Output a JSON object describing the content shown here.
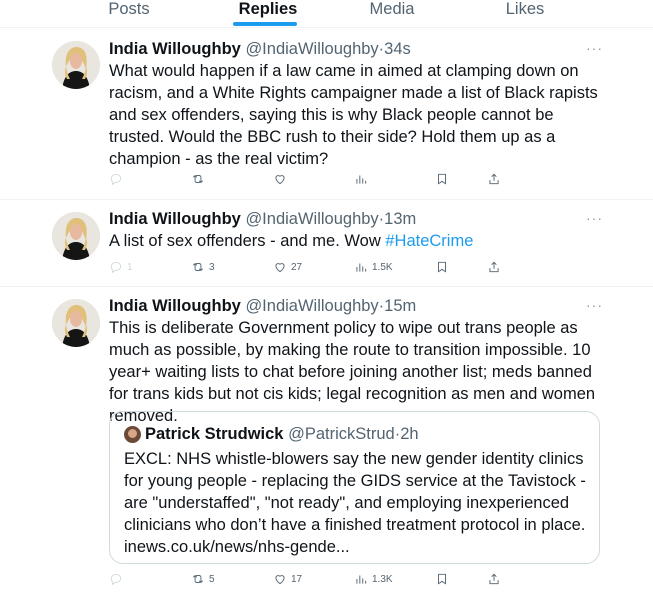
{
  "tabs": [
    {
      "label": "Posts"
    },
    {
      "label": "Replies"
    },
    {
      "label": "Media"
    },
    {
      "label": "Likes"
    }
  ],
  "tweets": [
    {
      "name": "India Willoughby",
      "handle": "@IndiaWilloughby",
      "separator": "·",
      "time": "34s",
      "more": "···",
      "text": "What would happen if a law came in aimed at clamping down on racism, and a White Rights campaigner made a list of Black rapists and sex offenders, saying this is why Black people cannot be trusted. Would the BBC rush to their side? Hold them up as a champion - as the real victim?",
      "replies": "",
      "reposts": "",
      "likes": "",
      "views": ""
    },
    {
      "name": "India Willoughby",
      "handle": "@IndiaWilloughby",
      "separator": "·",
      "time": "13m",
      "more": "···",
      "text": "A list of sex offenders - and me. Wow ",
      "hashtag": "#HateCrime",
      "replies": "1",
      "reposts": "3",
      "likes": "27",
      "views": "1.5K"
    },
    {
      "name": "India Willoughby",
      "handle": "@IndiaWilloughby",
      "separator": "·",
      "time": "15m",
      "more": "···",
      "text": "This is deliberate Government policy to wipe out trans people as much as possible, by making the route to transition impossible. 10 year+ waiting lists to chat before joining another list; meds banned for trans kids but not cis kids; legal recognition as men and women removed.",
      "replies": "",
      "reposts": "5",
      "likes": "17",
      "views": "1.3K",
      "quote": {
        "name": "Patrick Strudwick",
        "handle": "@PatrickStrud",
        "separator": "·",
        "time": "2h",
        "text": "EXCL: NHS whistle-blowers say the new gender identity clinics for young people - replacing the GIDS service at the Tavistock - are \"understaffed\", \"not ready\", and  employing inexperienced clinicians who don’t have a finished treatment protocol in place. inews.co.uk/news/nhs-gende..."
      }
    }
  ],
  "colors": {
    "accent": "#1d9bf0",
    "text": "#0f1419",
    "muted": "#536471",
    "border": "#eff3f4"
  },
  "icons": {
    "reply": "reply-icon",
    "repost": "repost-icon",
    "like": "heart-icon",
    "views": "analytics-icon",
    "bookmark": "bookmark-icon",
    "share": "share-icon",
    "more": "more-icon"
  }
}
